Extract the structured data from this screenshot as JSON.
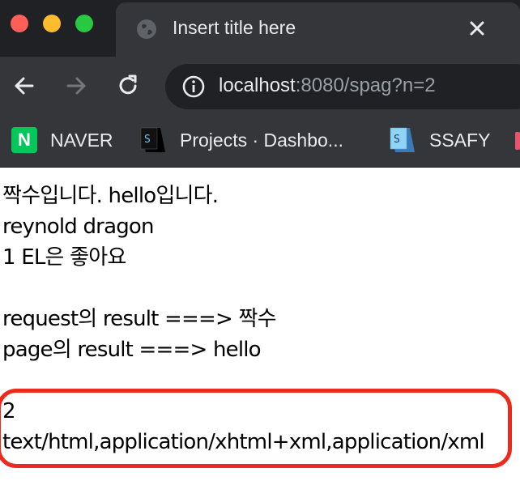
{
  "window": {
    "traffic_lights": [
      {
        "name": "close",
        "color": "#ff5f57"
      },
      {
        "name": "minimize",
        "color": "#febc2e"
      },
      {
        "name": "zoom",
        "color": "#28c840"
      }
    ]
  },
  "tab": {
    "icon": "globe-icon",
    "title": "Insert title here",
    "close_icon": "close-icon"
  },
  "toolbar": {
    "back_icon": "back-arrow-icon",
    "forward_icon": "forward-arrow-icon",
    "reload_icon": "reload-icon",
    "info_icon": "info-icon",
    "url_host": "localhost",
    "url_rest": ":8080/spag?n=2"
  },
  "bookmarks": [
    {
      "icon": "naver-icon",
      "icon_text": "N",
      "label": "NAVER"
    },
    {
      "icon": "ssafy-icon",
      "icon_text": "S",
      "label": "Projects · Dashbo..."
    },
    {
      "icon": "ssafy-icon",
      "icon_text": "S",
      "label": "SSAFY"
    }
  ],
  "page": {
    "lines": [
      "짝수입니다. hello입니다.",
      "reynold dragon",
      "1 EL은 좋아요",
      "",
      "request의 result ===> 짝수",
      "page의 result ===> hello",
      ""
    ],
    "highlighted_lines": [
      "2",
      "text/html,application/xhtml+xml,application/xml"
    ],
    "highlight_color": "#ee2a1c"
  }
}
